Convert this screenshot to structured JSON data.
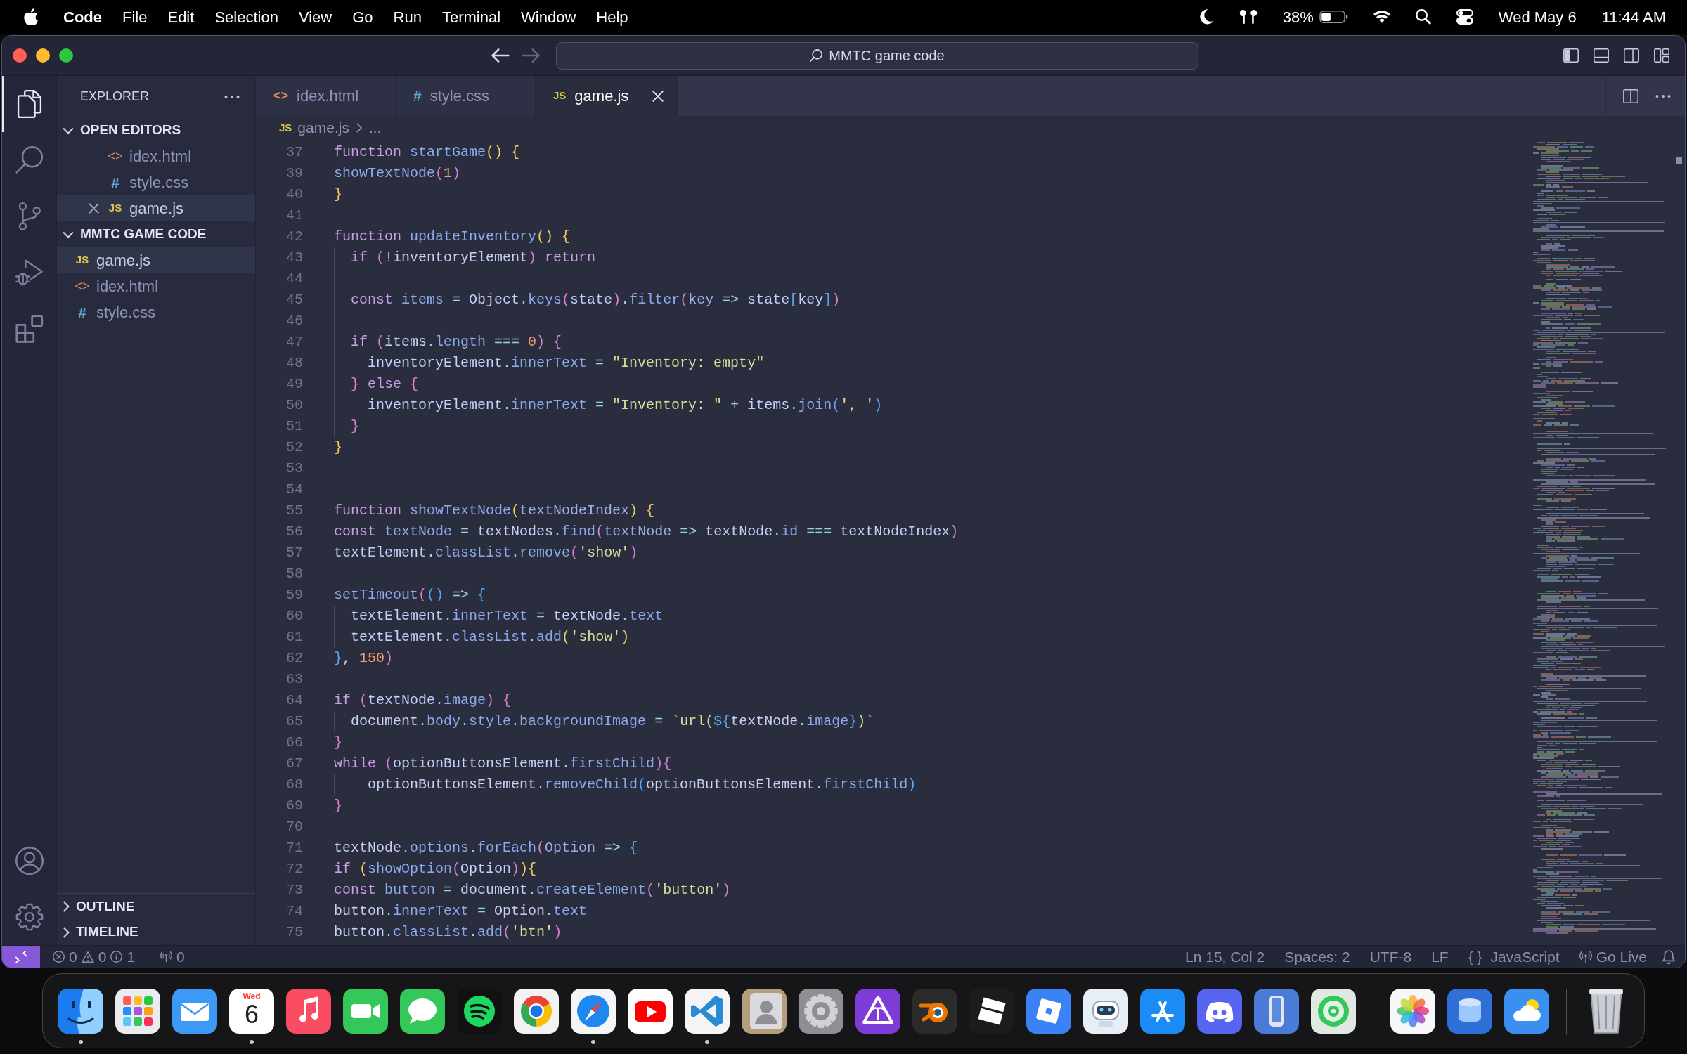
{
  "menu_bar": {
    "app_name": "Code",
    "menus": [
      "File",
      "Edit",
      "Selection",
      "View",
      "Go",
      "Run",
      "Terminal",
      "Window",
      "Help"
    ],
    "battery": "38%",
    "date": "Wed May 6",
    "time": "11:44 AM"
  },
  "title_bar": {
    "back_disabled": false,
    "forward_disabled": true,
    "command_center": "MMTC game code"
  },
  "activity_bar": {
    "items": [
      {
        "kind": "files",
        "selected": true
      },
      {
        "kind": "search",
        "selected": false
      },
      {
        "kind": "source-control",
        "selected": false
      },
      {
        "kind": "run-debug",
        "selected": false
      },
      {
        "kind": "extensions",
        "selected": false
      }
    ],
    "bottom_items": [
      {
        "kind": "account"
      },
      {
        "kind": "settings"
      }
    ]
  },
  "sidebar": {
    "title": "EXPLORER",
    "sections": [
      {
        "title": "OPEN EDITORS",
        "kind": "open-editors",
        "expanded": true,
        "items": [
          {
            "icon": "<>",
            "kind": "html",
            "label": "idex.html",
            "selected": false,
            "close": false
          },
          {
            "icon": "#",
            "kind": "css",
            "label": "style.css",
            "selected": false,
            "close": false
          },
          {
            "icon": "JS",
            "kind": "js",
            "label": "game.js",
            "selected": true,
            "close": true
          }
        ]
      },
      {
        "title": "MMTC GAME CODE",
        "kind": "folder",
        "expanded": true,
        "items": [
          {
            "icon": "JS",
            "kind": "js",
            "label": "game.js",
            "selected": true
          },
          {
            "icon": "<>",
            "kind": "html",
            "label": "idex.html",
            "selected": false
          },
          {
            "icon": "#",
            "kind": "css",
            "label": "style.css",
            "selected": false
          }
        ]
      }
    ],
    "panels": [
      {
        "title": "OUTLINE",
        "expanded": false
      },
      {
        "title": "TIMELINE",
        "expanded": false
      }
    ]
  },
  "tabs": [
    {
      "icon": "<>",
      "kind": "html",
      "label": "idex.html",
      "selected": false
    },
    {
      "icon": "#",
      "kind": "css",
      "label": "style.css",
      "selected": false
    },
    {
      "icon": "JS",
      "kind": "js",
      "label": "game.js",
      "selected": true
    }
  ],
  "breadcrumb": {
    "icon": "JS",
    "kind": "js",
    "file": "game.js",
    "more": "..."
  },
  "editor": {
    "lines": [
      {
        "number": "37",
        "tokens": [
          {
            "text": "function ",
            "kind": "keyword"
          },
          {
            "text": "startGame",
            "kind": "name"
          },
          {
            "text": "() {",
            "kind": "bracket-1"
          }
        ]
      },
      {
        "number": "39",
        "tokens": [
          {
            "text": "showTextNode",
            "kind": "name"
          },
          {
            "text": "(",
            "kind": "bracket-2"
          },
          {
            "text": "1",
            "kind": "number"
          },
          {
            "text": ")",
            "kind": "bracket-2"
          }
        ]
      },
      {
        "number": "40",
        "tokens": [
          {
            "text": "}",
            "kind": "bracket-1"
          }
        ]
      },
      {
        "number": "41"
      },
      {
        "number": "42",
        "tokens": [
          {
            "text": "function ",
            "kind": "keyword"
          },
          {
            "text": "updateInventory",
            "kind": "name"
          },
          {
            "text": "() {",
            "kind": "bracket-1"
          }
        ]
      },
      {
        "number": "43",
        "tokens": [
          {
            "text": "  if ",
            "kind": "keyword"
          },
          {
            "text": "(",
            "kind": "bracket-2"
          },
          {
            "text": "!",
            "kind": "operator"
          },
          {
            "text": "inventoryElement",
            "kind": "plain"
          },
          {
            "text": ") ",
            "kind": "bracket-2"
          },
          {
            "text": "return",
            "kind": "keyword"
          }
        ]
      },
      {
        "number": "44"
      },
      {
        "number": "45",
        "tokens": [
          {
            "text": "  const ",
            "kind": "keyword"
          },
          {
            "text": "items ",
            "kind": "name"
          },
          {
            "text": "= ",
            "kind": "operator"
          },
          {
            "text": "Object",
            "kind": "plain"
          },
          {
            "text": ".",
            "kind": "operator"
          },
          {
            "text": "keys",
            "kind": "name"
          },
          {
            "text": "(",
            "kind": "bracket-2"
          },
          {
            "text": "state",
            "kind": "plain"
          },
          {
            "text": ")",
            "kind": "bracket-2"
          },
          {
            "text": ".",
            "kind": "operator"
          },
          {
            "text": "filter",
            "kind": "name"
          },
          {
            "text": "(",
            "kind": "bracket-2"
          },
          {
            "text": "key ",
            "kind": "param"
          },
          {
            "text": "=> ",
            "kind": "operator"
          },
          {
            "text": "state",
            "kind": "plain"
          },
          {
            "text": "[",
            "kind": "bracket-3"
          },
          {
            "text": "key",
            "kind": "plain"
          },
          {
            "text": "]",
            "kind": "bracket-3"
          },
          {
            "text": ")",
            "kind": "bracket-2"
          }
        ]
      },
      {
        "number": "46"
      },
      {
        "number": "47",
        "tokens": [
          {
            "text": "  if ",
            "kind": "keyword"
          },
          {
            "text": "(",
            "kind": "bracket-2"
          },
          {
            "text": "items",
            "kind": "plain"
          },
          {
            "text": ".",
            "kind": "operator"
          },
          {
            "text": "length ",
            "kind": "name"
          },
          {
            "text": "=== ",
            "kind": "operator"
          },
          {
            "text": "0",
            "kind": "number"
          },
          {
            "text": ") {",
            "kind": "bracket-2"
          }
        ]
      },
      {
        "number": "48",
        "tokens": [
          {
            "text": "    inventoryElement",
            "kind": "plain"
          },
          {
            "text": ".",
            "kind": "operator"
          },
          {
            "text": "innerText ",
            "kind": "name"
          },
          {
            "text": "= ",
            "kind": "operator"
          },
          {
            "text": "\"Inventory: empty\"",
            "kind": "string"
          }
        ]
      },
      {
        "number": "49",
        "tokens": [
          {
            "text": "  } ",
            "kind": "bracket-2"
          },
          {
            "text": "else ",
            "kind": "keyword"
          },
          {
            "text": "{",
            "kind": "bracket-2"
          }
        ]
      },
      {
        "number": "50",
        "tokens": [
          {
            "text": "    inventoryElement",
            "kind": "plain"
          },
          {
            "text": ".",
            "kind": "operator"
          },
          {
            "text": "innerText ",
            "kind": "name"
          },
          {
            "text": "= ",
            "kind": "operator"
          },
          {
            "text": "\"Inventory: \" ",
            "kind": "string"
          },
          {
            "text": "+ ",
            "kind": "operator"
          },
          {
            "text": "items",
            "kind": "plain"
          },
          {
            "text": ".",
            "kind": "operator"
          },
          {
            "text": "join",
            "kind": "name"
          },
          {
            "text": "(",
            "kind": "bracket-3"
          },
          {
            "text": "', '",
            "kind": "string"
          },
          {
            "text": ")",
            "kind": "bracket-3"
          }
        ]
      },
      {
        "number": "51",
        "tokens": [
          {
            "text": "  }",
            "kind": "bracket-2"
          }
        ]
      },
      {
        "number": "52",
        "tokens": [
          {
            "text": "}",
            "kind": "bracket-1"
          }
        ]
      },
      {
        "number": "53"
      },
      {
        "number": "54"
      },
      {
        "number": "55",
        "tokens": [
          {
            "text": "function ",
            "kind": "keyword"
          },
          {
            "text": "showTextNode",
            "kind": "name"
          },
          {
            "text": "(",
            "kind": "bracket-1"
          },
          {
            "text": "textNodeIndex",
            "kind": "param"
          },
          {
            "text": ") {",
            "kind": "bracket-1"
          }
        ]
      },
      {
        "number": "56",
        "tokens": [
          {
            "text": "const ",
            "kind": "keyword"
          },
          {
            "text": "textNode ",
            "kind": "name"
          },
          {
            "text": "= ",
            "kind": "operator"
          },
          {
            "text": "textNodes",
            "kind": "plain"
          },
          {
            "text": ".",
            "kind": "operator"
          },
          {
            "text": "find",
            "kind": "name"
          },
          {
            "text": "(",
            "kind": "bracket-2"
          },
          {
            "text": "textNode ",
            "kind": "param"
          },
          {
            "text": "=> ",
            "kind": "operator"
          },
          {
            "text": "textNode",
            "kind": "plain"
          },
          {
            "text": ".",
            "kind": "operator"
          },
          {
            "text": "id ",
            "kind": "name"
          },
          {
            "text": "=== ",
            "kind": "operator"
          },
          {
            "text": "textNodeIndex",
            "kind": "plain"
          },
          {
            "text": ")",
            "kind": "bracket-2"
          }
        ]
      },
      {
        "number": "57",
        "tokens": [
          {
            "text": "textElement",
            "kind": "plain"
          },
          {
            "text": ".",
            "kind": "operator"
          },
          {
            "text": "classList",
            "kind": "name"
          },
          {
            "text": ".",
            "kind": "operator"
          },
          {
            "text": "remove",
            "kind": "name"
          },
          {
            "text": "(",
            "kind": "bracket-2"
          },
          {
            "text": "'show'",
            "kind": "string"
          },
          {
            "text": ")",
            "kind": "bracket-2"
          }
        ]
      },
      {
        "number": "58"
      },
      {
        "number": "59",
        "tokens": [
          {
            "text": "setTimeout",
            "kind": "name"
          },
          {
            "text": "(",
            "kind": "bracket-2"
          },
          {
            "text": "() ",
            "kind": "bracket-3"
          },
          {
            "text": "=> ",
            "kind": "operator"
          },
          {
            "text": "{",
            "kind": "bracket-3"
          }
        ]
      },
      {
        "number": "60",
        "tokens": [
          {
            "text": "  textElement",
            "kind": "plain"
          },
          {
            "text": ".",
            "kind": "operator"
          },
          {
            "text": "innerText ",
            "kind": "name"
          },
          {
            "text": "= ",
            "kind": "operator"
          },
          {
            "text": "textNode",
            "kind": "plain"
          },
          {
            "text": ".",
            "kind": "operator"
          },
          {
            "text": "text",
            "kind": "name"
          }
        ]
      },
      {
        "number": "61",
        "tokens": [
          {
            "text": "  textElement",
            "kind": "plain"
          },
          {
            "text": ".",
            "kind": "operator"
          },
          {
            "text": "classList",
            "kind": "name"
          },
          {
            "text": ".",
            "kind": "operator"
          },
          {
            "text": "add",
            "kind": "name"
          },
          {
            "text": "(",
            "kind": "bracket-1"
          },
          {
            "text": "'show'",
            "kind": "string"
          },
          {
            "text": ")",
            "kind": "bracket-1"
          }
        ]
      },
      {
        "number": "62",
        "tokens": [
          {
            "text": "}",
            "kind": "bracket-3"
          },
          {
            "text": ", ",
            "kind": "plain"
          },
          {
            "text": "150",
            "kind": "number"
          },
          {
            "text": ")",
            "kind": "bracket-2"
          }
        ]
      },
      {
        "number": "63"
      },
      {
        "number": "64",
        "tokens": [
          {
            "text": "if ",
            "kind": "keyword"
          },
          {
            "text": "(",
            "kind": "bracket-2"
          },
          {
            "text": "textNode",
            "kind": "plain"
          },
          {
            "text": ".",
            "kind": "operator"
          },
          {
            "text": "image",
            "kind": "name"
          },
          {
            "text": ") {",
            "kind": "bracket-2"
          }
        ]
      },
      {
        "number": "65",
        "tokens": [
          {
            "text": "  document",
            "kind": "plain"
          },
          {
            "text": ".",
            "kind": "operator"
          },
          {
            "text": "body",
            "kind": "name"
          },
          {
            "text": ".",
            "kind": "operator"
          },
          {
            "text": "style",
            "kind": "name"
          },
          {
            "text": ".",
            "kind": "operator"
          },
          {
            "text": "backgroundImage ",
            "kind": "name"
          },
          {
            "text": "= ",
            "kind": "operator"
          },
          {
            "text": "`url(",
            "kind": "string"
          },
          {
            "text": "${",
            "kind": "bracket-3"
          },
          {
            "text": "textNode",
            "kind": "plain"
          },
          {
            "text": ".",
            "kind": "operator"
          },
          {
            "text": "image",
            "kind": "name"
          },
          {
            "text": "}",
            "kind": "bracket-3"
          },
          {
            "text": ")`",
            "kind": "string"
          }
        ]
      },
      {
        "number": "66",
        "tokens": [
          {
            "text": "}",
            "kind": "bracket-2"
          }
        ]
      },
      {
        "number": "67",
        "tokens": [
          {
            "text": "while ",
            "kind": "keyword"
          },
          {
            "text": "(",
            "kind": "bracket-2"
          },
          {
            "text": "optionButtonsElement",
            "kind": "plain"
          },
          {
            "text": ".",
            "kind": "operator"
          },
          {
            "text": "firstChild",
            "kind": "name"
          },
          {
            "text": "){",
            "kind": "bracket-2"
          }
        ]
      },
      {
        "number": "68",
        "tokens": [
          {
            "text": "    optionButtonsElement",
            "kind": "plain"
          },
          {
            "text": ".",
            "kind": "operator"
          },
          {
            "text": "removeChild",
            "kind": "name"
          },
          {
            "text": "(",
            "kind": "bracket-3"
          },
          {
            "text": "optionButtonsElement",
            "kind": "plain"
          },
          {
            "text": ".",
            "kind": "operator"
          },
          {
            "text": "firstChild",
            "kind": "name"
          },
          {
            "text": ")",
            "kind": "bracket-3"
          }
        ]
      },
      {
        "number": "69",
        "tokens": [
          {
            "text": "}",
            "kind": "bracket-2"
          }
        ]
      },
      {
        "number": "70"
      },
      {
        "number": "71",
        "tokens": [
          {
            "text": "textNode",
            "kind": "plain"
          },
          {
            "text": ".",
            "kind": "operator"
          },
          {
            "text": "options",
            "kind": "name"
          },
          {
            "text": ".",
            "kind": "operator"
          },
          {
            "text": "forEach",
            "kind": "name"
          },
          {
            "text": "(",
            "kind": "bracket-2"
          },
          {
            "text": "Option ",
            "kind": "param"
          },
          {
            "text": "=> ",
            "kind": "operator"
          },
          {
            "text": "{",
            "kind": "bracket-3"
          }
        ]
      },
      {
        "number": "72",
        "tokens": [
          {
            "text": "if ",
            "kind": "keyword"
          },
          {
            "text": "(",
            "kind": "bracket-1"
          },
          {
            "text": "showOption",
            "kind": "name"
          },
          {
            "text": "(",
            "kind": "bracket-2"
          },
          {
            "text": "Option",
            "kind": "plain"
          },
          {
            "text": ")",
            "kind": "bracket-2"
          },
          {
            "text": "){",
            "kind": "bracket-1"
          }
        ]
      },
      {
        "number": "73",
        "tokens": [
          {
            "text": "const ",
            "kind": "keyword"
          },
          {
            "text": "button ",
            "kind": "name"
          },
          {
            "text": "= ",
            "kind": "operator"
          },
          {
            "text": "document",
            "kind": "plain"
          },
          {
            "text": ".",
            "kind": "operator"
          },
          {
            "text": "createElement",
            "kind": "name"
          },
          {
            "text": "(",
            "kind": "bracket-2"
          },
          {
            "text": "'button'",
            "kind": "string"
          },
          {
            "text": ")",
            "kind": "bracket-2"
          }
        ]
      },
      {
        "number": "74",
        "tokens": [
          {
            "text": "button",
            "kind": "plain"
          },
          {
            "text": ".",
            "kind": "operator"
          },
          {
            "text": "innerText ",
            "kind": "name"
          },
          {
            "text": "= ",
            "kind": "operator"
          },
          {
            "text": "Option",
            "kind": "plain"
          },
          {
            "text": ".",
            "kind": "operator"
          },
          {
            "text": "text",
            "kind": "name"
          }
        ]
      },
      {
        "number": "75",
        "tokens": [
          {
            "text": "button",
            "kind": "plain"
          },
          {
            "text": ".",
            "kind": "operator"
          },
          {
            "text": "classList",
            "kind": "name"
          },
          {
            "text": ".",
            "kind": "operator"
          },
          {
            "text": "add",
            "kind": "name"
          },
          {
            "text": "(",
            "kind": "bracket-2"
          },
          {
            "text": "'btn'",
            "kind": "string"
          },
          {
            "text": ")",
            "kind": "bracket-2"
          }
        ]
      }
    ]
  },
  "status_bar": {
    "errors": "0",
    "warnings": "0",
    "infos": "1",
    "ports": "0",
    "position": "Ln 15, Col 2",
    "indentation": "Spaces: 2",
    "encoding": "UTF-8",
    "line_ending": "LF",
    "language_icon": "{ }",
    "language": "JavaScript",
    "live_server": "Go Live"
  },
  "dock": {
    "items": [
      {
        "kind": "face",
        "running": true
      },
      {
        "kind": "grid",
        "running": false
      },
      {
        "kind": "mail",
        "running": false
      },
      {
        "kind": "calendar",
        "running": true,
        "day": "Wed",
        "date": "6"
      },
      {
        "kind": "music",
        "running": false
      },
      {
        "kind": "video",
        "running": false
      },
      {
        "kind": "chat",
        "running": false
      },
      {
        "kind": "waves",
        "running": false
      },
      {
        "kind": "ring",
        "running": false
      },
      {
        "kind": "compass",
        "running": true
      },
      {
        "kind": "play",
        "running": false
      },
      {
        "kind": "ribbon",
        "running": true
      },
      {
        "kind": "contacts",
        "running": false
      },
      {
        "kind": "gear",
        "running": false
      },
      {
        "kind": "triangle",
        "running": false
      },
      {
        "kind": "orbit",
        "running": false
      },
      {
        "kind": "blocks",
        "running": false
      },
      {
        "kind": "cube",
        "running": false
      },
      {
        "kind": "robot",
        "running": false
      },
      {
        "kind": "store",
        "running": false
      },
      {
        "kind": "controller",
        "running": false
      },
      {
        "kind": "phone",
        "running": false
      },
      {
        "kind": "target",
        "running": false
      },
      {
        "kind": "separator"
      },
      {
        "kind": "flower",
        "running": false
      },
      {
        "kind": "cylinder",
        "running": false
      },
      {
        "kind": "cloud",
        "running": false
      },
      {
        "kind": "separator"
      },
      {
        "kind": "bin",
        "running": false
      }
    ]
  }
}
